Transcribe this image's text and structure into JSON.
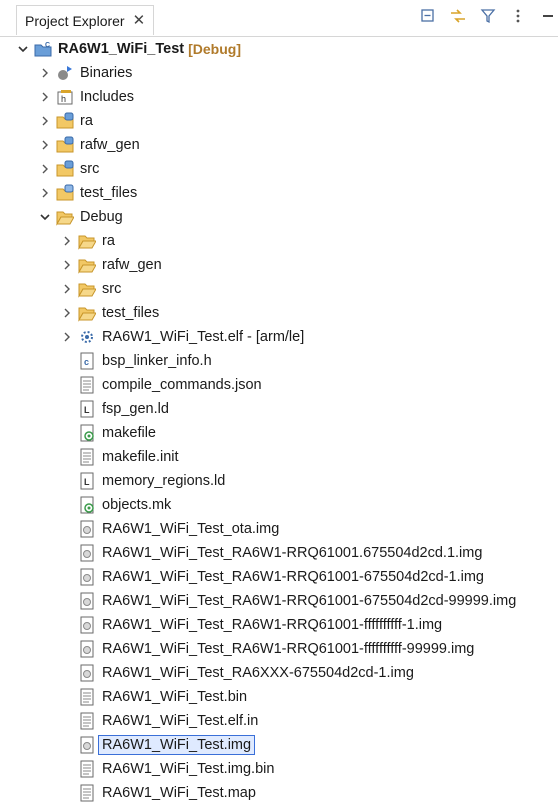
{
  "view": {
    "tab_title": "Project Explorer",
    "toolbar": [
      {
        "name": "collapse-all-icon"
      },
      {
        "name": "link-with-editor-icon"
      },
      {
        "name": "filter-icon"
      },
      {
        "name": "view-menu-icon"
      },
      {
        "name": "minimize-icon"
      }
    ]
  },
  "tree": {
    "project": {
      "label": "RA6W1_WiFi_Test",
      "decoration": "[Debug]"
    },
    "items": [
      {
        "label": "Binaries"
      },
      {
        "label": "Includes"
      },
      {
        "label": "ra"
      },
      {
        "label": "rafw_gen"
      },
      {
        "label": "src"
      },
      {
        "label": "test_files"
      },
      {
        "label": "Debug"
      },
      {
        "label": "ra"
      },
      {
        "label": "rafw_gen"
      },
      {
        "label": "src"
      },
      {
        "label": "test_files"
      },
      {
        "label": "RA6W1_WiFi_Test.elf - [arm/le]"
      },
      {
        "label": "bsp_linker_info.h"
      },
      {
        "label": "compile_commands.json"
      },
      {
        "label": "fsp_gen.ld"
      },
      {
        "label": "makefile"
      },
      {
        "label": "makefile.init"
      },
      {
        "label": "memory_regions.ld"
      },
      {
        "label": "objects.mk"
      },
      {
        "label": "RA6W1_WiFi_Test_ota.img"
      },
      {
        "label": "RA6W1_WiFi_Test_RA6W1-RRQ61001.675504d2cd.1.img"
      },
      {
        "label": "RA6W1_WiFi_Test_RA6W1-RRQ61001-675504d2cd-1.img"
      },
      {
        "label": "RA6W1_WiFi_Test_RA6W1-RRQ61001-675504d2cd-99999.img"
      },
      {
        "label": "RA6W1_WiFi_Test_RA6W1-RRQ61001-ffffffffff-1.img"
      },
      {
        "label": "RA6W1_WiFi_Test_RA6W1-RRQ61001-ffffffffff-99999.img"
      },
      {
        "label": "RA6W1_WiFi_Test_RA6XXX-675504d2cd-1.img"
      },
      {
        "label": "RA6W1_WiFi_Test.bin"
      },
      {
        "label": "RA6W1_WiFi_Test.elf.in"
      },
      {
        "label": "RA6W1_WiFi_Test.img"
      },
      {
        "label": "RA6W1_WiFi_Test.img.bin"
      },
      {
        "label": "RA6W1_WiFi_Test.map"
      }
    ]
  }
}
